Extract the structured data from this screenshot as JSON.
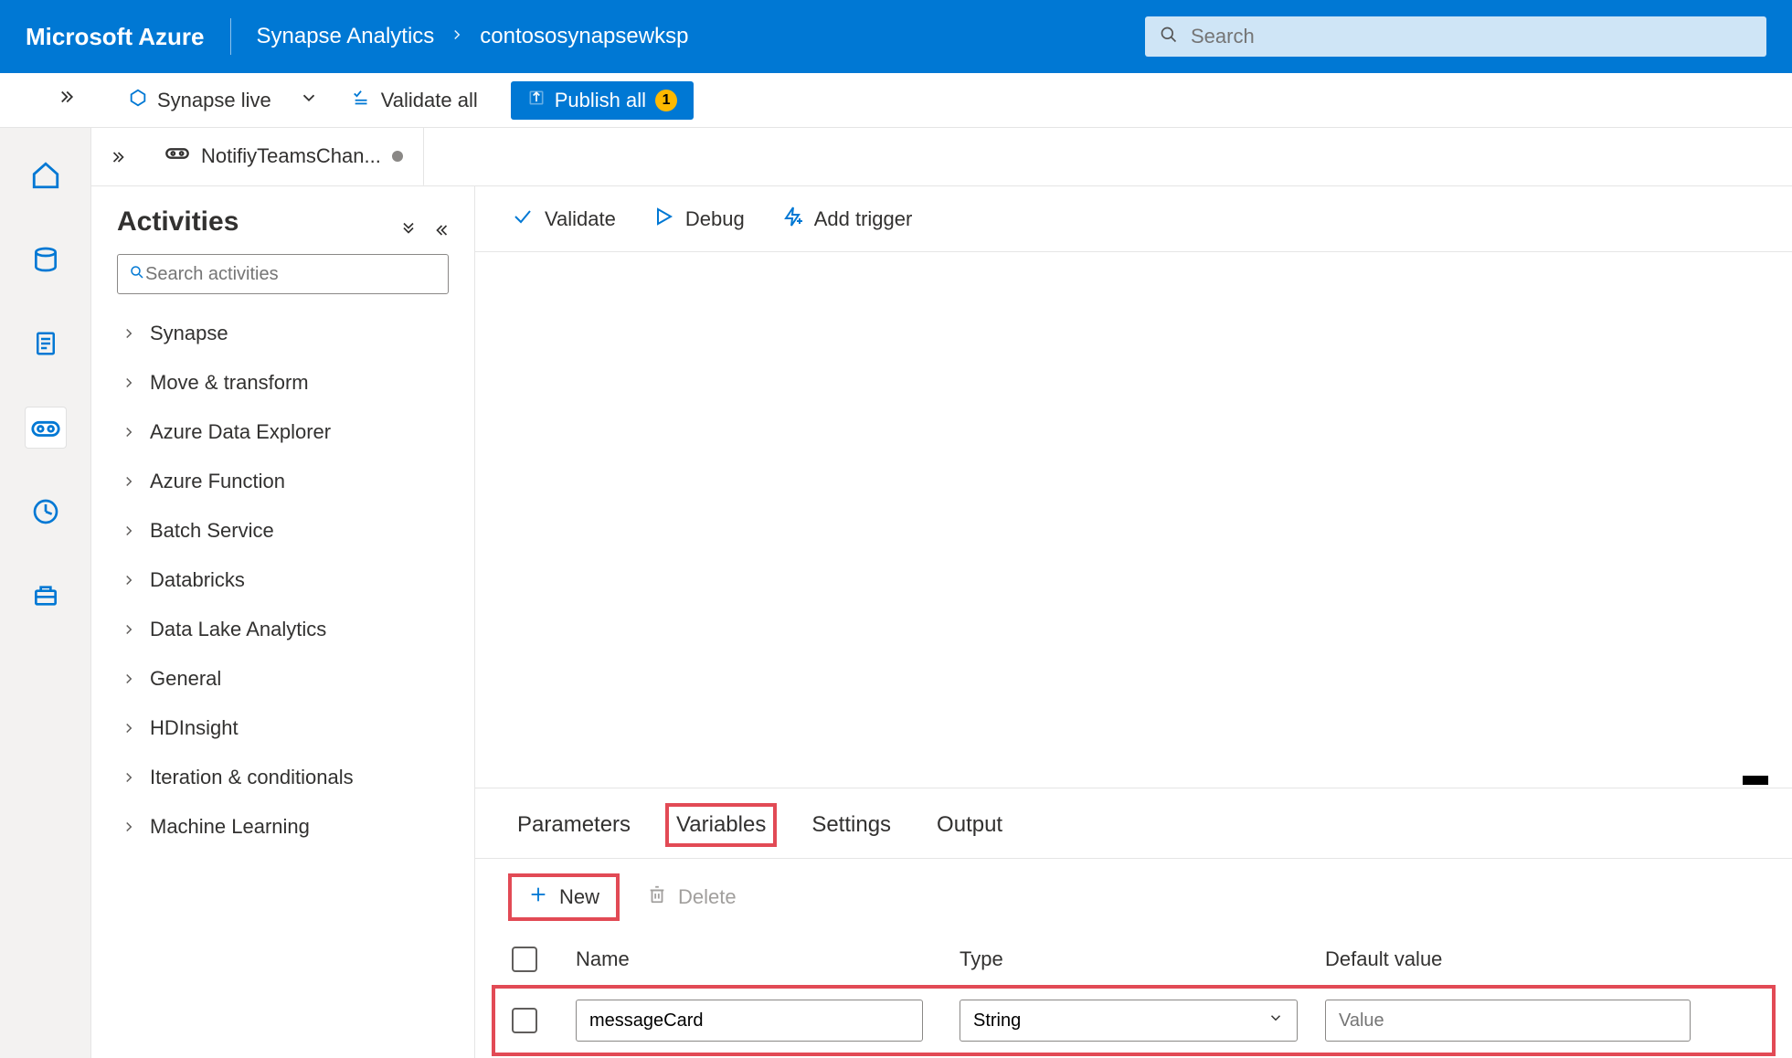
{
  "header": {
    "brand": "Microsoft Azure",
    "crumb1": "Synapse Analytics",
    "crumb2": "contososynapsewksp",
    "search_placeholder": "Search"
  },
  "toolbar": {
    "live_label": "Synapse live",
    "validate_all": "Validate all",
    "publish_all": "Publish all",
    "publish_count": "1"
  },
  "tab": {
    "pipeline_name": "NotifiyTeamsChan..."
  },
  "activities": {
    "title": "Activities",
    "search_placeholder": "Search activities",
    "items": [
      "Synapse",
      "Move & transform",
      "Azure Data Explorer",
      "Azure Function",
      "Batch Service",
      "Databricks",
      "Data Lake Analytics",
      "General",
      "HDInsight",
      "Iteration & conditionals",
      "Machine Learning"
    ]
  },
  "canvas_toolbar": {
    "validate": "Validate",
    "debug": "Debug",
    "add_trigger": "Add trigger"
  },
  "bottom_tabs": {
    "parameters": "Parameters",
    "variables": "Variables",
    "settings": "Settings",
    "output": "Output"
  },
  "bottom_actions": {
    "new": "New",
    "delete": "Delete"
  },
  "grid": {
    "head_name": "Name",
    "head_type": "Type",
    "head_default": "Default value",
    "row": {
      "name": "messageCard",
      "type": "String",
      "default_placeholder": "Value"
    }
  }
}
